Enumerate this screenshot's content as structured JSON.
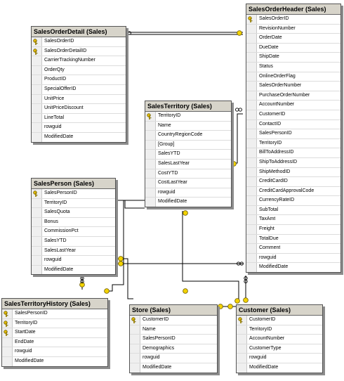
{
  "tables": [
    {
      "id": "sod",
      "name": "SalesOrderDetail (Sales)",
      "columns": [
        {
          "name": "SalesOrderID",
          "key": true
        },
        {
          "name": "SalesOrderDetailID",
          "key": true
        },
        {
          "name": "CarrierTrackingNumber"
        },
        {
          "name": "OrderQty"
        },
        {
          "name": "ProductID"
        },
        {
          "name": "SpecialOfferID"
        },
        {
          "name": "UnitPrice"
        },
        {
          "name": "UnitPriceDiscount"
        },
        {
          "name": "LineTotal"
        },
        {
          "name": "rowguid"
        },
        {
          "name": "ModifiedDate"
        }
      ]
    },
    {
      "id": "soh",
      "name": "SalesOrderHeader (Sales)",
      "columns": [
        {
          "name": "SalesOrderID",
          "key": true
        },
        {
          "name": "RevisionNumber"
        },
        {
          "name": "OrderDate"
        },
        {
          "name": "DueDate"
        },
        {
          "name": "ShipDate"
        },
        {
          "name": "Status"
        },
        {
          "name": "OnlineOrderFlag"
        },
        {
          "name": "SalesOrderNumber"
        },
        {
          "name": "PurchaseOrderNumber"
        },
        {
          "name": "AccountNumber"
        },
        {
          "name": "CustomerID"
        },
        {
          "name": "ContactID"
        },
        {
          "name": "SalesPersonID"
        },
        {
          "name": "TerritoryID"
        },
        {
          "name": "BillToAddressID"
        },
        {
          "name": "ShipToAddressID"
        },
        {
          "name": "ShipMethodID"
        },
        {
          "name": "CreditCardID"
        },
        {
          "name": "CreditCardApprovalCode"
        },
        {
          "name": "CurrencyRateID"
        },
        {
          "name": "SubTotal"
        },
        {
          "name": "TaxAmt"
        },
        {
          "name": "Freight"
        },
        {
          "name": "TotalDue"
        },
        {
          "name": "Comment"
        },
        {
          "name": "rowguid"
        },
        {
          "name": "ModifiedDate"
        }
      ]
    },
    {
      "id": "st",
      "name": "SalesTerritory (Sales)",
      "columns": [
        {
          "name": "TerritoryID",
          "key": true
        },
        {
          "name": "Name"
        },
        {
          "name": "CountryRegionCode"
        },
        {
          "name": "[Group]"
        },
        {
          "name": "SalesYTD"
        },
        {
          "name": "SalesLastYear"
        },
        {
          "name": "CostYTD"
        },
        {
          "name": "CostLastYear"
        },
        {
          "name": "rowguid"
        },
        {
          "name": "ModifiedDate"
        }
      ]
    },
    {
      "id": "sp",
      "name": "SalesPerson (Sales)",
      "columns": [
        {
          "name": "SalesPersonID",
          "key": true
        },
        {
          "name": "TerritoryID"
        },
        {
          "name": "SalesQuota"
        },
        {
          "name": "Bonus"
        },
        {
          "name": "CommissionPct"
        },
        {
          "name": "SalesYTD"
        },
        {
          "name": "SalesLastYear"
        },
        {
          "name": "rowguid"
        },
        {
          "name": "ModifiedDate"
        }
      ]
    },
    {
      "id": "sth",
      "name": "SalesTerritoryHistory (Sales)",
      "columns": [
        {
          "name": "SalesPersonID",
          "key": true
        },
        {
          "name": "TerritoryID",
          "key": true
        },
        {
          "name": "StartDate",
          "key": true
        },
        {
          "name": "EndDate"
        },
        {
          "name": "rowguid"
        },
        {
          "name": "ModifiedDate"
        }
      ]
    },
    {
      "id": "store",
      "name": "Store (Sales)",
      "columns": [
        {
          "name": "CustomerID",
          "key": true
        },
        {
          "name": "Name"
        },
        {
          "name": "SalesPersonID"
        },
        {
          "name": "Demographics"
        },
        {
          "name": "rowguid"
        },
        {
          "name": "ModifiedDate"
        }
      ]
    },
    {
      "id": "cust",
      "name": "Customer (Sales)",
      "columns": [
        {
          "name": "CustomerID",
          "key": true
        },
        {
          "name": "TerritoryID"
        },
        {
          "name": "AccountNumber"
        },
        {
          "name": "CustomerType"
        },
        {
          "name": "rowguid"
        },
        {
          "name": "ModifiedDate"
        }
      ]
    }
  ],
  "relationships": [
    {
      "from": "sod",
      "to": "soh"
    },
    {
      "from": "soh",
      "to": "st"
    },
    {
      "from": "soh",
      "to": "sp"
    },
    {
      "from": "soh",
      "to": "cust"
    },
    {
      "from": "sp",
      "to": "st"
    },
    {
      "from": "sth",
      "to": "sp"
    },
    {
      "from": "sth",
      "to": "st"
    },
    {
      "from": "store",
      "to": "sp"
    },
    {
      "from": "store",
      "to": "cust"
    },
    {
      "from": "cust",
      "to": "st"
    }
  ],
  "colors": {
    "title_bar": "#d7d4ca",
    "key_icon": "#e8c000",
    "line": "#000000",
    "connector_end": "#f2d200"
  },
  "icons": {
    "primary_key": "key-icon",
    "many_end": "infinity-icon",
    "one_end": "key-end-icon"
  }
}
